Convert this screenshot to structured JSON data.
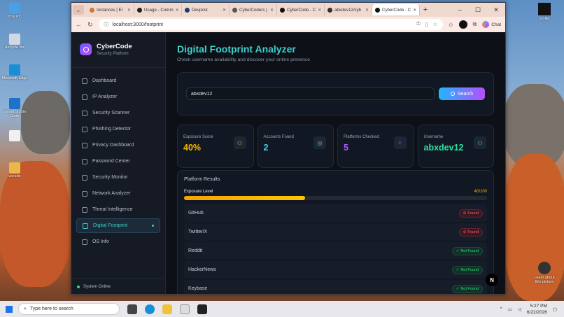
{
  "desktop": {
    "icons": [
      {
        "label": "This PC",
        "icon": "computer-icon"
      },
      {
        "label": "Recycle Bin",
        "icon": "recycle-bin-icon"
      },
      {
        "label": "Microsoft Edge",
        "icon": "edge-icon"
      },
      {
        "label": "Visual Studio Code",
        "icon": "vscode-icon"
      },
      {
        "label": "",
        "icon": "file-icon"
      },
      {
        "label": "vscode",
        "icon": "folder-icon"
      }
    ],
    "right_icons": [
      {
        "label": "profile",
        "icon": "profile-icon"
      },
      {
        "label": "Learn about this picture",
        "icon": "camera-icon"
      }
    ]
  },
  "browser": {
    "tabs": [
      {
        "label": "Instances | El",
        "color": "#c77b3a"
      },
      {
        "label": "Usage - Comm",
        "color": "#222222"
      },
      {
        "label": "Devpost",
        "color": "#1c3d6b"
      },
      {
        "label": "CyberCoders |",
        "color": "#555555"
      },
      {
        "label": "CyberCode - C",
        "color": "#111111"
      },
      {
        "label": "abxdev12/cyb",
        "color": "#333333"
      },
      {
        "label": "CyberCode - C",
        "color": "#111111",
        "active": true
      }
    ],
    "url": "localhost:3000/footprint",
    "chat_label": "Chat"
  },
  "app": {
    "brand_name": "CyberCode",
    "brand_sub": "Security Platform",
    "nav": [
      {
        "label": "Dashboard"
      },
      {
        "label": "IP Analyzer"
      },
      {
        "label": "Security Scanner"
      },
      {
        "label": "Phishing Detector"
      },
      {
        "label": "Privacy Dashboard"
      },
      {
        "label": "Password Center"
      },
      {
        "label": "Security Monitor"
      },
      {
        "label": "Network Analyzer"
      },
      {
        "label": "Threat Intelligence"
      },
      {
        "label": "Digital Footprint",
        "active": true
      },
      {
        "label": "OS Info"
      }
    ],
    "system_status": "System Online",
    "title": "Digital Footprint Analyzer",
    "subtitle": "Check username availability and discover your online presence",
    "search": {
      "value": "abxdev12",
      "button": "Search"
    },
    "stats": [
      {
        "label": "Exposure Score",
        "value": "40%",
        "color": "#f5b400"
      },
      {
        "label": "Accounts Found",
        "value": "2",
        "color": "#3ad6e8"
      },
      {
        "label": "Platforms Checked",
        "value": "5",
        "color": "#a45cff"
      },
      {
        "label": "Username",
        "value": "abxdev12",
        "color": "#2ee0a0"
      }
    ],
    "results_title": "Platform Results",
    "exposure": {
      "label": "Exposure Level",
      "value_text": "40/100",
      "fraction": 0.4
    },
    "platforms": [
      {
        "name": "GitHub",
        "status": "Found",
        "found": true
      },
      {
        "name": "Twitter/X",
        "status": "Found",
        "found": true
      },
      {
        "name": "Reddit",
        "status": "Not Found",
        "found": false
      },
      {
        "name": "HackerNews",
        "status": "Not Found",
        "found": false
      },
      {
        "name": "Keybase",
        "status": "Not Found",
        "found": false
      }
    ],
    "fab_label": "N"
  },
  "taskbar": {
    "search_placeholder": "Type here to search",
    "time": "5:27 PM",
    "date": "6/22/2026"
  }
}
